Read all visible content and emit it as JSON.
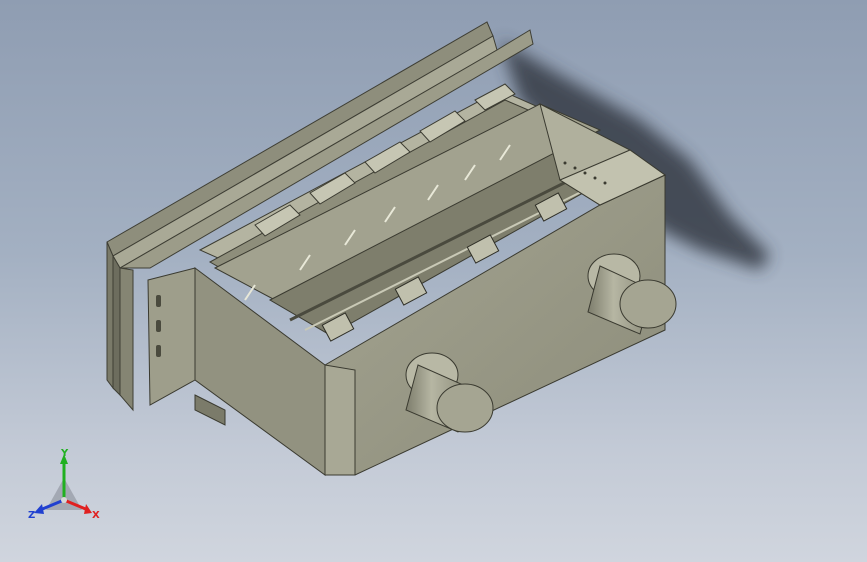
{
  "viewport": {
    "background_top": "#8f9db2",
    "background_bottom": "#d0d5de"
  },
  "model": {
    "body_color": "#9a9a88",
    "body_dark": "#6f6f60",
    "body_light": "#b8b8a6",
    "cylinder_color": "#a6a694",
    "shadow_color": "#3a3f48"
  },
  "triad": {
    "x_label": "X",
    "y_label": "Y",
    "z_label": "Z",
    "x_color": "#e02020",
    "y_color": "#20b020",
    "z_color": "#2040d0"
  }
}
